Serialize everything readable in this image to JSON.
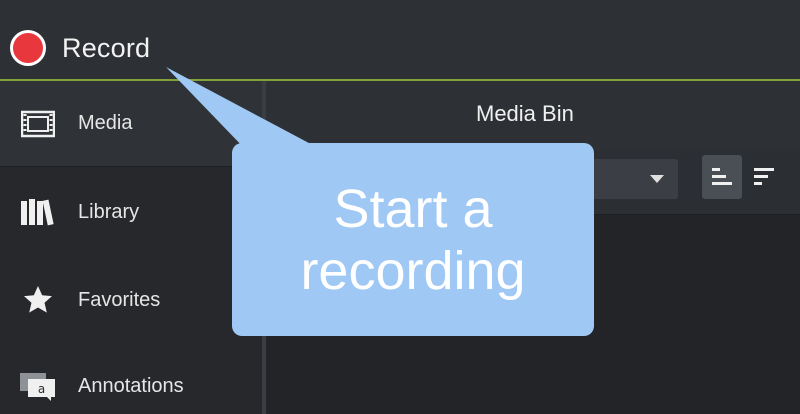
{
  "record": {
    "label": "Record",
    "color": "#e8383d"
  },
  "sidebar": {
    "items": [
      {
        "label": "Media",
        "icon": "film-icon",
        "active": true
      },
      {
        "label": "Library",
        "icon": "books-icon",
        "active": false
      },
      {
        "label": "Favorites",
        "icon": "star-icon",
        "active": false
      },
      {
        "label": "Annotations",
        "icon": "annotation-icon",
        "active": false
      }
    ]
  },
  "main": {
    "title": "Media Bin"
  },
  "callout": {
    "text": "Start a\nrecording",
    "color": "#9fc8f4"
  },
  "colors": {
    "accent_line": "#7fa33a",
    "background": "#2b2e33"
  }
}
